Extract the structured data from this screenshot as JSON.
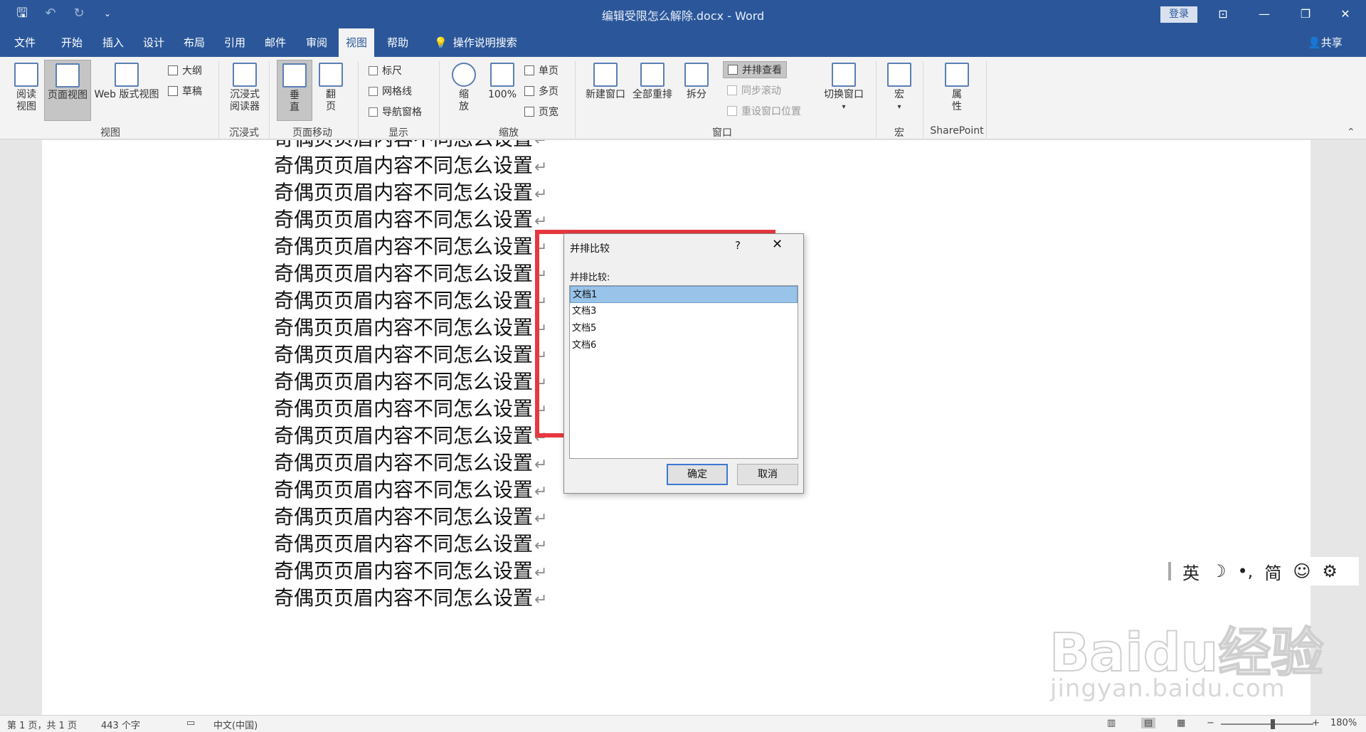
{
  "window": {
    "title": "编辑受限怎么解除.docx - Word",
    "login": "登录",
    "controls": {
      "ribbon_display": "⊡",
      "minimize": "—",
      "restore": "❐",
      "close": "✕"
    }
  },
  "qat": {
    "save": "🖫",
    "undo": "↶",
    "redo": "↻",
    "customize": "⌄"
  },
  "tabs": [
    {
      "label": "文件"
    },
    {
      "label": "开始"
    },
    {
      "label": "插入"
    },
    {
      "label": "设计"
    },
    {
      "label": "布局"
    },
    {
      "label": "引用"
    },
    {
      "label": "邮件"
    },
    {
      "label": "审阅"
    },
    {
      "label": "视图"
    },
    {
      "label": "帮助"
    },
    {
      "label": "操作说明搜索"
    }
  ],
  "share": "共享",
  "ribbon": {
    "views": {
      "read_mode": "阅读\n视图",
      "print_layout": "页面视图",
      "web_layout": "Web 版式视图",
      "outline": "大纲",
      "draft": "草稿",
      "group": "视图"
    },
    "immersive": {
      "reader": "沉浸式\n阅读器",
      "group": "沉浸式"
    },
    "page_move": {
      "vertical": "垂\n直",
      "side_to_side": "翻\n页",
      "group": "页面移动"
    },
    "show": {
      "ruler": "标尺",
      "gridlines": "网格线",
      "nav_pane": "导航窗格",
      "group": "显示"
    },
    "zoom": {
      "zoom": "缩\n放",
      "hundred": "100%",
      "one_page": "单页",
      "multi_page": "多页",
      "page_width": "页宽",
      "group": "缩放"
    },
    "window": {
      "new_window": "新建窗口",
      "arrange_all": "全部重排",
      "split": "拆分",
      "side_by_side": "并排查看",
      "sync_scroll": "同步滚动",
      "reset_pos": "重设窗口位置",
      "switch": "切换窗口",
      "group": "窗口"
    },
    "macros": {
      "macros": "宏",
      "group": "宏"
    },
    "sharepoint": {
      "properties": "属\n性",
      "group": "SharePoint"
    }
  },
  "document": {
    "line_text": "奇偶页页眉内容不同怎么设置",
    "para_mark": "↵"
  },
  "dialog": {
    "title": "并排比较",
    "help": "?",
    "close": "✕",
    "label": "并排比较:",
    "items": [
      "文档1",
      "文档3",
      "文档5",
      "文档6"
    ],
    "ok": "确定",
    "cancel": "取消"
  },
  "ime": {
    "lang": "英",
    "moon": "☽",
    "punct": "•,",
    "simp": "简",
    "emoji": "☺",
    "settings": "⚙"
  },
  "watermark": {
    "brand": "Baidu经验",
    "url": "jingyan.baidu.com"
  },
  "status": {
    "page": "第 1 页，共 1 页",
    "words": "443 个字",
    "lang": "中文(中国)",
    "zoom_minus": "−",
    "zoom_plus": "+",
    "zoom": "180%"
  },
  "colors": {
    "accent": "#2b579a",
    "highlight": "#e8383f",
    "selection": "#99c3e8"
  }
}
